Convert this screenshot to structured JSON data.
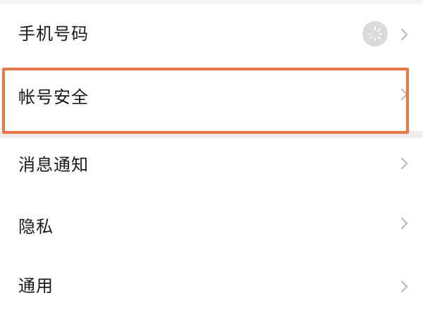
{
  "settings": {
    "items": [
      {
        "label": "手机号码",
        "icon": "chevron-right-icon",
        "status_icon": "loading-spinner-icon"
      },
      {
        "label": "帐号安全",
        "icon": "chevron-right-icon",
        "highlighted": true,
        "highlight_color": "#ED7742"
      },
      {
        "label": "消息通知",
        "icon": "chevron-right-icon"
      },
      {
        "label": "隐私",
        "icon": "chevron-right-icon"
      },
      {
        "label": "通用",
        "icon": "chevron-right-icon"
      }
    ]
  },
  "colors": {
    "background": "#EDEDED",
    "row_background": "#FFFFFF",
    "text": "#1A1A1A",
    "chevron": "#B8B8B8",
    "highlight": "#ED7742"
  }
}
